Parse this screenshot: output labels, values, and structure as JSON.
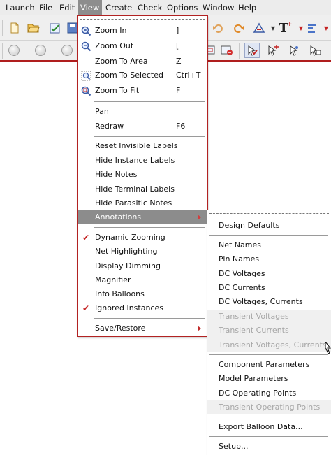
{
  "menubar": {
    "items": [
      {
        "label": "Launch"
      },
      {
        "label": "File"
      },
      {
        "label": "Edit"
      },
      {
        "label": "View"
      },
      {
        "label": "Create"
      },
      {
        "label": "Check"
      },
      {
        "label": "Options"
      },
      {
        "label": "Window"
      },
      {
        "label": "Help"
      }
    ],
    "active_color": "#8d8d8d"
  },
  "toolbar1": {
    "icons": [
      "new-file-icon",
      "open-folder-icon",
      "check-save-icon",
      "save-icon",
      "undo-icon",
      "redo-icon",
      "stretch-icon",
      "text-icon",
      "align-icon"
    ]
  },
  "toolbar2": {
    "icons": [
      "nav-back-icon",
      "nav-forward-icon",
      "nav-up-icon",
      "zoom-fit-icon",
      "delete-icon",
      "select-check-icon",
      "select-arrow-icon",
      "select-move-icon",
      "select-copy-icon"
    ]
  },
  "view_menu": {
    "items": [
      {
        "label": "Zoom In",
        "accel": "]",
        "icon": "zoom-in-icon"
      },
      {
        "label": "Zoom Out",
        "accel": "[",
        "icon": "zoom-out-icon"
      },
      {
        "label": "Zoom To Area",
        "accel": "Z",
        "icon": "zoom-area-icon"
      },
      {
        "label": "Zoom To Selected",
        "accel": "Ctrl+T",
        "icon": "zoom-selected-icon"
      },
      {
        "label": "Zoom To Fit",
        "accel": "F",
        "icon": "zoom-fit-icon"
      },
      {
        "label": "Pan"
      },
      {
        "label": "Redraw",
        "accel": "F6"
      },
      {
        "label": "Reset Invisible Labels"
      },
      {
        "label": "Hide Instance Labels"
      },
      {
        "label": "Hide Notes"
      },
      {
        "label": "Hide Terminal Labels"
      },
      {
        "label": "Hide Parasitic Notes"
      },
      {
        "label": "Annotations",
        "submenu": true,
        "highlighted": true
      },
      {
        "label": "Dynamic Zooming",
        "checked": true
      },
      {
        "label": "Net Highlighting"
      },
      {
        "label": "Display Dimming"
      },
      {
        "label": "Magnifier"
      },
      {
        "label": "Info Balloons"
      },
      {
        "label": "Ignored Instances",
        "checked": true
      },
      {
        "label": "Save/Restore",
        "submenu": true
      }
    ],
    "border_color": "#b22222",
    "check_color": "#c42121"
  },
  "annotations_menu": {
    "items": [
      {
        "label": "Design Defaults"
      },
      {
        "label": "Net Names"
      },
      {
        "label": "Pin Names"
      },
      {
        "label": "DC Voltages"
      },
      {
        "label": "DC Currents"
      },
      {
        "label": "DC Voltages, Currents"
      },
      {
        "label": "Transient Voltages",
        "disabled": true
      },
      {
        "label": "Transient Currents",
        "disabled": true
      },
      {
        "label": "Transient Voltages, Currents",
        "disabled": true
      },
      {
        "label": "Component Parameters"
      },
      {
        "label": "Model Parameters"
      },
      {
        "label": "DC Operating Points"
      },
      {
        "label": "Transient Operating Points",
        "disabled": true
      },
      {
        "label": "Export Balloon Data..."
      },
      {
        "label": "Setup..."
      }
    ],
    "disabled_color": "#a6a6a6"
  }
}
